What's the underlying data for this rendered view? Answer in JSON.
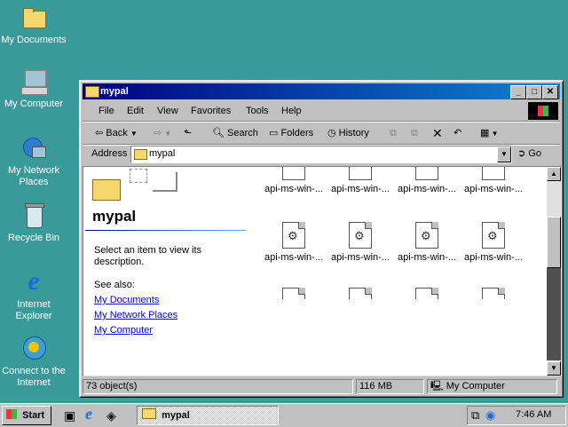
{
  "desktop": {
    "icons": [
      {
        "label": "My Documents"
      },
      {
        "label": "My Computer"
      },
      {
        "label": "My Network Places"
      },
      {
        "label": "Recycle Bin"
      },
      {
        "label": "Internet Explorer"
      },
      {
        "label": "Connect to the Internet"
      }
    ]
  },
  "window": {
    "title": "mypal",
    "menu": [
      "File",
      "Edit",
      "View",
      "Favorites",
      "Tools",
      "Help"
    ],
    "toolbar": {
      "back": "Back",
      "search": "Search",
      "folders": "Folders",
      "history": "History"
    },
    "address": {
      "label": "Address",
      "value": "mypal",
      "go": "Go"
    },
    "sidepane": {
      "folder_title": "mypal",
      "hint": "Select an item to view its description.",
      "see_also": "See also:",
      "links": [
        "My Documents",
        "My Network Places",
        "My Computer"
      ]
    },
    "files": {
      "label": "api-ms-win-...",
      "rows": [
        [
          "api-ms-win-...",
          "api-ms-win-...",
          "api-ms-win-...",
          "api-ms-win-..."
        ],
        [
          "api-ms-win-...",
          "api-ms-win-...",
          "api-ms-win-...",
          "api-ms-win-..."
        ]
      ]
    },
    "status": {
      "objects": "73 object(s)",
      "size": "116 MB",
      "zone": "My Computer"
    }
  },
  "taskbar": {
    "start": "Start",
    "task": "mypal",
    "clock": "7:46 AM"
  },
  "colors": {
    "desktop": "#3a9a9a",
    "title_active": "#000080",
    "link": "#0000ee"
  }
}
